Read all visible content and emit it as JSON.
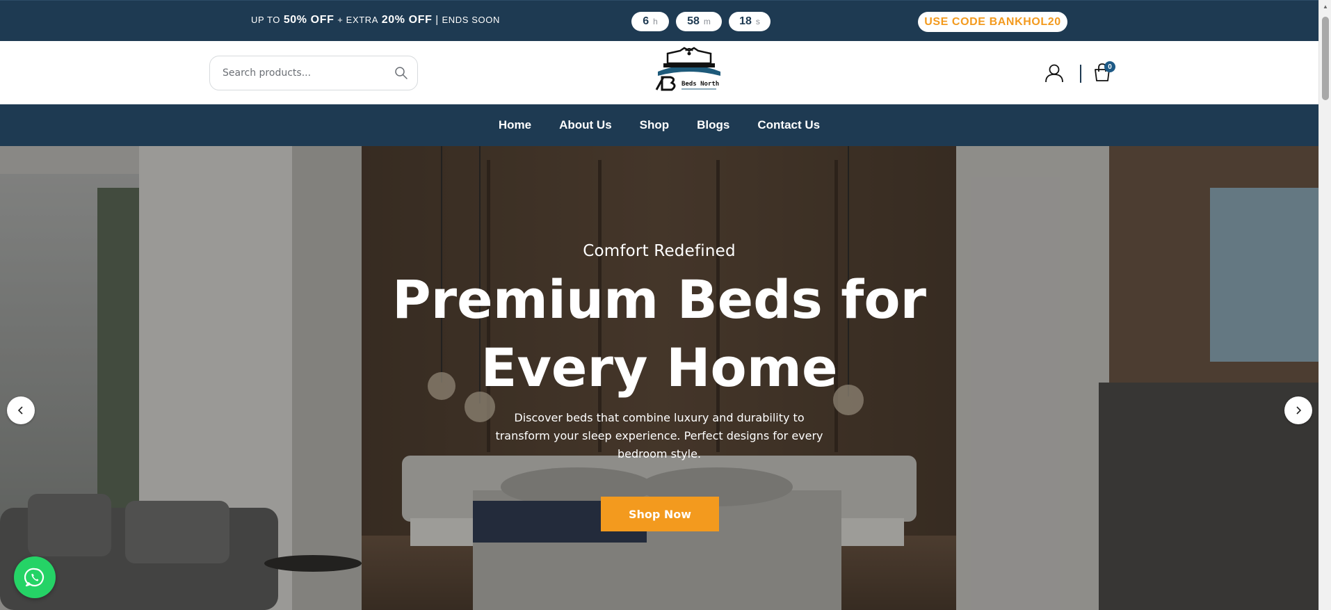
{
  "promo": {
    "prefix": "UP TO",
    "discount": "50% OFF",
    "plus_extra": "+ EXTRA",
    "extra_discount": "20% OFF",
    "separator": "|",
    "suffix": "ENDS SOON",
    "countdown": {
      "hours": "6",
      "hours_unit": "h",
      "minutes": "58",
      "minutes_unit": "m",
      "seconds": "18",
      "seconds_unit": "s"
    },
    "code_label": "USE CODE BANKHOL20"
  },
  "header": {
    "search_placeholder": "Search products...",
    "logo_text": "Beds North",
    "logo_icon": "bed-logo",
    "cart_count": "0",
    "icons": [
      "search-icon",
      "account-icon",
      "cart-icon"
    ]
  },
  "nav": {
    "items": [
      {
        "label": "Home"
      },
      {
        "label": "About Us"
      },
      {
        "label": "Shop"
      },
      {
        "label": "Blogs"
      },
      {
        "label": "Contact Us"
      }
    ]
  },
  "hero": {
    "subtitle": "Comfort Redefined",
    "title_line1": "Premium Beds for",
    "title_line2": "Every Home",
    "description": "Discover beds that combine luxury and durability to transform your sleep experience. Perfect designs for every bedroom style.",
    "cta_label": "Shop Now"
  },
  "colors": {
    "navy": "#1e3a52",
    "accent_orange": "#f39a1e",
    "whatsapp_green": "#25d366"
  }
}
